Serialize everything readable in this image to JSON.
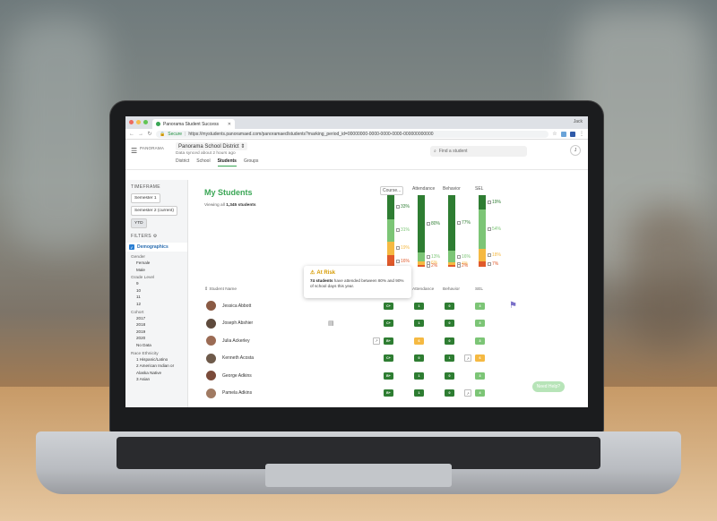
{
  "browser": {
    "tab_title": "Panorama Student Success",
    "tab_close": "✕",
    "user": "Jack",
    "secure_label": "Secure",
    "url": "https://mystudents.panoramaed.com/panoramaed/students?marking_period_id=00000000-0000-0000-0000-000000000000"
  },
  "header": {
    "logo": "PANORAMA",
    "district": "Panorama School District",
    "synced": "Data synced about 2 hours ago",
    "tabs": [
      "District",
      "School",
      "Students",
      "Groups"
    ],
    "active_tab": "Students",
    "search_placeholder": "Find a student",
    "avatar_initial": "J"
  },
  "sidebar": {
    "timeframe_heading": "TIMEFRAME",
    "timeframes": [
      "Semester 1",
      "Semester 2 (current)",
      "YTD"
    ],
    "selected_timeframe": "YTD",
    "filters_heading": "FILTERS",
    "demographics": "Demographics",
    "groups": [
      {
        "label": "Gender",
        "options": [
          "Female",
          "Male"
        ]
      },
      {
        "label": "Grade Level",
        "options": [
          "9",
          "10",
          "11",
          "12"
        ]
      },
      {
        "label": "Cohort",
        "options": [
          "2017",
          "2018",
          "2019",
          "2020",
          "No Data"
        ]
      },
      {
        "label": "Race Ethnicity",
        "options": [
          "1 Hispanic/Latino",
          "2 American Indian or Alaska Native",
          "3 Asian"
        ]
      }
    ]
  },
  "main": {
    "title": "My Students",
    "viewing_prefix": "Viewing all ",
    "viewing_count": "1,345 students",
    "chart_headers": [
      "Course...",
      "Attendance",
      "Behavior",
      "SEL"
    ],
    "charts": [
      {
        "name": "course",
        "segments": [
          {
            "color": "#2e7d32",
            "value": 33
          },
          {
            "color": "#7cc576",
            "value": 31
          },
          {
            "color": "#f5b942",
            "value": 19
          },
          {
            "color": "#e05a2b",
            "value": 16
          }
        ],
        "labels": [
          "33%",
          "31%",
          "19%",
          "16%"
        ]
      },
      {
        "name": "attendance",
        "segments": [
          {
            "color": "#2e7d32",
            "value": 80
          },
          {
            "color": "#7cc576",
            "value": 13
          },
          {
            "color": "#f5b942",
            "value": 5
          },
          {
            "color": "#e05a2b",
            "value": 2
          }
        ],
        "labels": [
          "80%",
          "13%",
          "6%",
          "2%"
        ]
      },
      {
        "name": "behavior",
        "segments": [
          {
            "color": "#2e7d32",
            "value": 77
          },
          {
            "color": "#7cc576",
            "value": 16
          },
          {
            "color": "#f5b942",
            "value": 4
          },
          {
            "color": "#e05a2b",
            "value": 2
          }
        ],
        "labels": [
          "77%",
          "16%",
          "4%",
          "2%"
        ]
      },
      {
        "name": "sel",
        "segments": [
          {
            "color": "#2e7d32",
            "value": 19
          },
          {
            "color": "#7cc576",
            "value": 54
          },
          {
            "color": "#f5b942",
            "value": 18
          },
          {
            "color": "#e05a2b",
            "value": 7
          }
        ],
        "labels": [
          "19%",
          "54%",
          "18%",
          "7%"
        ]
      }
    ],
    "tooltip": {
      "title": "At Risk",
      "bold": "74 students",
      "text": " have attended between 80% and 90% of school days this year."
    },
    "columns": {
      "student": "Student Name",
      "attendance": "Attendance",
      "behavior": "Behavior",
      "sel": "SEL"
    },
    "students": [
      {
        "name": "Jessica Abbott",
        "grade": "C+",
        "attendance": "1",
        "behavior": "0",
        "sel": "3"
      },
      {
        "name": "Joseph Abshier",
        "grade": "C+",
        "attendance": "1",
        "behavior": "0",
        "sel": "3"
      },
      {
        "name": "Julia Ackerley",
        "grade": "B+",
        "attendance": "6",
        "behavior": "0",
        "sel": "3"
      },
      {
        "name": "Kenneth Acosta",
        "grade": "C+",
        "attendance": "0",
        "behavior": "1",
        "sel": "6"
      },
      {
        "name": "George Adkins",
        "grade": "B+",
        "attendance": "1",
        "behavior": "0",
        "sel": "3"
      },
      {
        "name": "Pamela Adkins",
        "grade": "B+",
        "attendance": "1",
        "behavior": "0",
        "sel": "4"
      }
    ],
    "need_help": "Need Help?"
  }
}
